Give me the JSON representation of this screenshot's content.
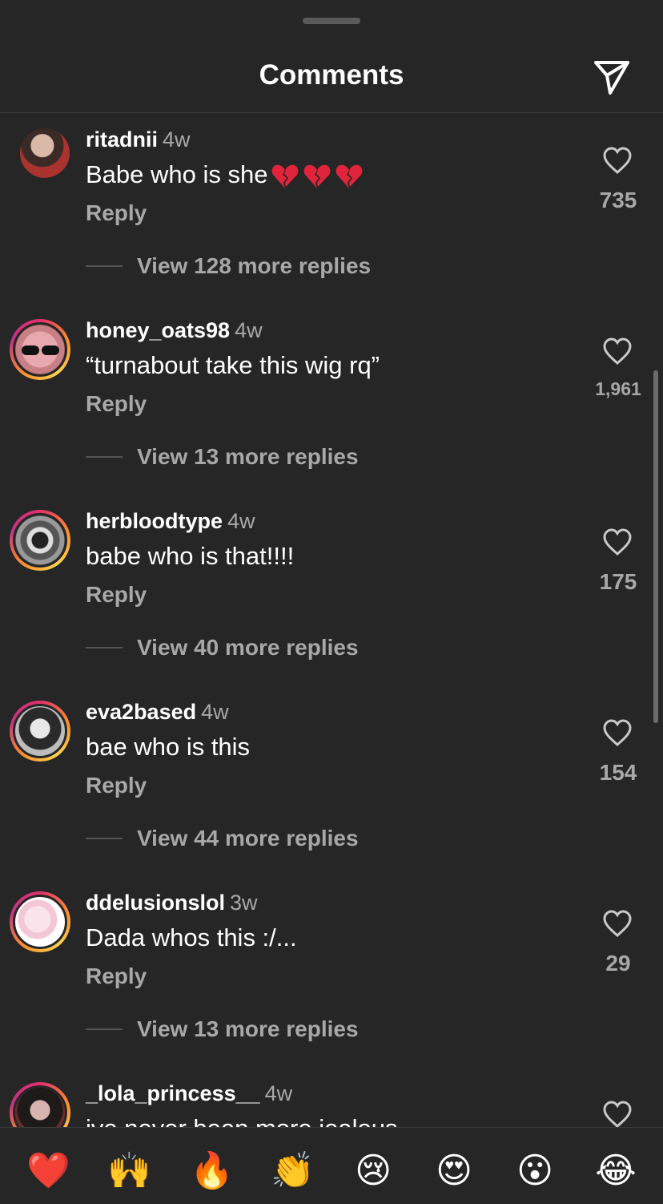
{
  "header": {
    "title": "Comments"
  },
  "comments": [
    {
      "user": "ritadnii",
      "time": "4w",
      "text": "Babe who is she",
      "text_emoji": "broken-heart-x3",
      "reply": "Reply",
      "view_replies": "View 128 more replies",
      "likes": "735"
    },
    {
      "user": "honey_oats98",
      "time": "4w",
      "text": "“turnabout take this wig rq”",
      "reply": "Reply",
      "view_replies": "View 13 more replies",
      "likes": "1,961"
    },
    {
      "user": "herbloodtype",
      "time": "4w",
      "text": "babe who is that!!!!",
      "reply": "Reply",
      "view_replies": "View 40 more replies",
      "likes": "175"
    },
    {
      "user": "eva2based",
      "time": "4w",
      "text": "bae who is this",
      "reply": "Reply",
      "view_replies": "View 44 more replies",
      "likes": "154"
    },
    {
      "user": "ddelusionslol",
      "time": "3w",
      "text": "Dada whos this :/...",
      "reply": "Reply",
      "view_replies": "View 13 more replies",
      "likes": "29"
    },
    {
      "user": "_lola_princess__",
      "time": "4w",
      "text": "ive never been more jealous",
      "likes": ""
    }
  ],
  "emoji_bar": [
    {
      "name": "red-heart",
      "glyph": "❤️"
    },
    {
      "name": "raising-hands",
      "glyph": "🙌"
    },
    {
      "name": "fire",
      "glyph": "🔥"
    },
    {
      "name": "clapping-hands",
      "glyph": "👏"
    },
    {
      "name": "crying-face",
      "glyph": "😢"
    },
    {
      "name": "heart-eyes",
      "glyph": "😍"
    },
    {
      "name": "surprised-face",
      "glyph": "😮"
    },
    {
      "name": "tears-of-joy",
      "glyph": "😂"
    }
  ],
  "colors": {
    "background": "#262626",
    "muted_text": "#a8a8a8",
    "ring": "#e1306c"
  }
}
